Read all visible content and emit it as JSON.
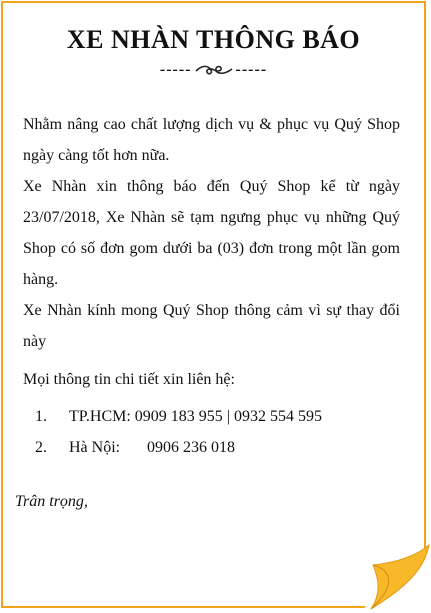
{
  "title": "XE NHÀN THÔNG BÁO",
  "divider": {
    "left": "-----",
    "right": "-----"
  },
  "paragraphs": [
    "Nhằm nâng cao chất lượng dịch vụ & phục vụ Quý Shop ngày càng tốt hơn nữa.",
    "Xe Nhàn xin thông báo đến Quý Shop kể từ ngày 23/07/2018, Xe Nhàn sẽ tạm ngưng phục vụ những Quý Shop có số đơn gom dưới ba (03) đơn trong một lần gom hàng.",
    "Xe Nhàn kính mong Quý Shop thông cảm vì sự thay đổi này"
  ],
  "contact_heading": "Mọi thông tin chi tiết xin liên hệ:",
  "contacts": [
    {
      "num": "1.",
      "label": "TP.HCM:",
      "phones": "0909 183 955 | 0932 554 595"
    },
    {
      "num": "2.",
      "label": "Hà Nội:",
      "phones": "0906 236 018"
    }
  ],
  "signature": "Trân trọng,",
  "colors": {
    "border": "#f2a21b",
    "fold": "#f7b82a"
  }
}
